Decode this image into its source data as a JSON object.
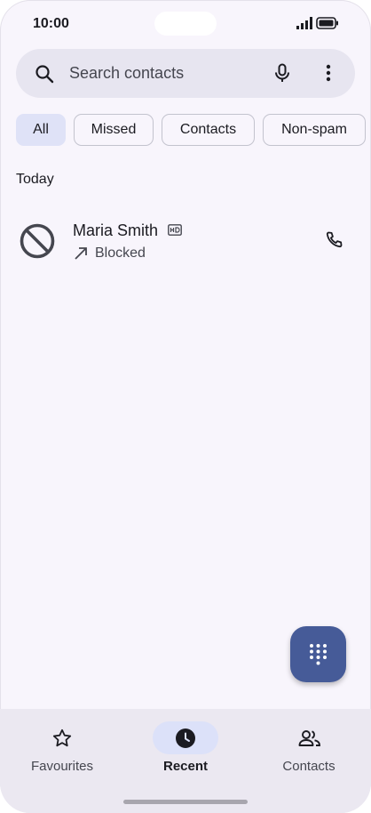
{
  "status_bar": {
    "time": "10:00"
  },
  "search": {
    "placeholder": "Search contacts",
    "icons": [
      "search-icon",
      "mic-icon",
      "more-vert-icon"
    ]
  },
  "filters": [
    {
      "label": "All",
      "selected": true
    },
    {
      "label": "Missed",
      "selected": false
    },
    {
      "label": "Contacts",
      "selected": false
    },
    {
      "label": "Non-spam",
      "selected": false
    }
  ],
  "section_header": "Today",
  "calls": [
    {
      "name": "Maria Smith",
      "status": "Blocked",
      "icon": "block-icon",
      "direction": "outgoing",
      "hd": true
    }
  ],
  "bottom_nav": [
    {
      "label": "Favourites",
      "icon": "star-icon",
      "active": false
    },
    {
      "label": "Recent",
      "icon": "clock-icon",
      "active": true
    },
    {
      "label": "Contacts",
      "icon": "people-icon",
      "active": false
    }
  ],
  "colors": {
    "background": "#f8f5fc",
    "accent": "#465b98",
    "chip_selected": "#dfe2f7",
    "nav_background": "#ebe8f1"
  }
}
